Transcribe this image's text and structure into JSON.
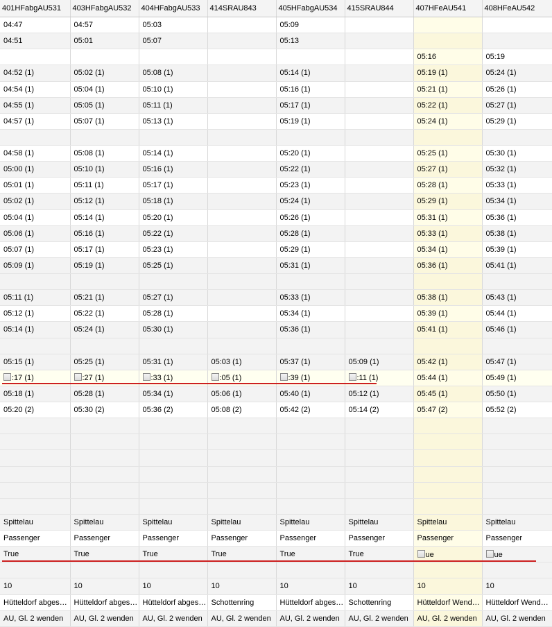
{
  "columns": [
    "401HFabgAU531",
    "403HFabgAU532",
    "404HFabgAU533",
    "414SRAU843",
    "405HFabgAU534",
    "415SRAU844",
    "407HFeAU541",
    "408HFeAU542"
  ],
  "highlight_column": 6,
  "rows": [
    {
      "cells": [
        "04:47",
        "04:57",
        "05:03",
        "",
        "05:09",
        "",
        "",
        ""
      ]
    },
    {
      "cells": [
        "04:51",
        "05:01",
        "05:07",
        "",
        "05:13",
        "",
        "",
        ""
      ]
    },
    {
      "cells": [
        "",
        "",
        "",
        "",
        "",
        "",
        "05:16",
        "05:19"
      ]
    },
    {
      "cells": [
        "04:52 (1)",
        "05:02 (1)",
        "05:08 (1)",
        "",
        "05:14 (1)",
        "",
        "05:19 (1)",
        "05:24 (1)"
      ]
    },
    {
      "cells": [
        "04:54 (1)",
        "05:04 (1)",
        "05:10 (1)",
        "",
        "05:16 (1)",
        "",
        "05:21 (1)",
        "05:26 (1)"
      ]
    },
    {
      "cells": [
        "04:55 (1)",
        "05:05 (1)",
        "05:11 (1)",
        "",
        "05:17 (1)",
        "",
        "05:22 (1)",
        "05:27 (1)"
      ]
    },
    {
      "cells": [
        "04:57 (1)",
        "05:07 (1)",
        "05:13 (1)",
        "",
        "05:19 (1)",
        "",
        "05:24 (1)",
        "05:29 (1)"
      ]
    },
    {
      "cells": [
        "",
        "",
        "",
        "",
        "",
        "",
        "",
        ""
      ]
    },
    {
      "cells": [
        "04:58 (1)",
        "05:08 (1)",
        "05:14 (1)",
        "",
        "05:20 (1)",
        "",
        "05:25 (1)",
        "05:30 (1)"
      ]
    },
    {
      "cells": [
        "05:00 (1)",
        "05:10 (1)",
        "05:16 (1)",
        "",
        "05:22 (1)",
        "",
        "05:27 (1)",
        "05:32 (1)"
      ]
    },
    {
      "cells": [
        "05:01 (1)",
        "05:11 (1)",
        "05:17 (1)",
        "",
        "05:23 (1)",
        "",
        "05:28 (1)",
        "05:33 (1)"
      ]
    },
    {
      "cells": [
        "05:02 (1)",
        "05:12 (1)",
        "05:18 (1)",
        "",
        "05:24 (1)",
        "",
        "05:29 (1)",
        "05:34 (1)"
      ]
    },
    {
      "cells": [
        "05:04 (1)",
        "05:14 (1)",
        "05:20 (1)",
        "",
        "05:26 (1)",
        "",
        "05:31 (1)",
        "05:36 (1)"
      ]
    },
    {
      "cells": [
        "05:06 (1)",
        "05:16 (1)",
        "05:22 (1)",
        "",
        "05:28 (1)",
        "",
        "05:33 (1)",
        "05:38 (1)"
      ]
    },
    {
      "cells": [
        "05:07 (1)",
        "05:17 (1)",
        "05:23 (1)",
        "",
        "05:29 (1)",
        "",
        "05:34 (1)",
        "05:39 (1)"
      ]
    },
    {
      "cells": [
        "05:09 (1)",
        "05:19 (1)",
        "05:25 (1)",
        "",
        "05:31 (1)",
        "",
        "05:36 (1)",
        "05:41 (1)"
      ]
    },
    {
      "cells": [
        "",
        "",
        "",
        "",
        "",
        "",
        "",
        ""
      ]
    },
    {
      "cells": [
        "05:11 (1)",
        "05:21 (1)",
        "05:27 (1)",
        "",
        "05:33 (1)",
        "",
        "05:38 (1)",
        "05:43 (1)"
      ]
    },
    {
      "cells": [
        "05:12 (1)",
        "05:22 (1)",
        "05:28 (1)",
        "",
        "05:34 (1)",
        "",
        "05:39 (1)",
        "05:44 (1)"
      ]
    },
    {
      "cells": [
        "05:14 (1)",
        "05:24 (1)",
        "05:30 (1)",
        "",
        "05:36 (1)",
        "",
        "05:41 (1)",
        "05:46 (1)"
      ]
    },
    {
      "cells": [
        "",
        "",
        "",
        "",
        "",
        "",
        "",
        ""
      ]
    },
    {
      "cells": [
        "05:15 (1)",
        "05:25 (1)",
        "05:31 (1)",
        "05:03 (1)",
        "05:37 (1)",
        "05:09 (1)",
        "05:42 (1)",
        "05:47 (1)"
      ]
    },
    {
      "highlight": true,
      "checkbox_cols": [
        0,
        1,
        2,
        3,
        4,
        5
      ],
      "cells": [
        ":17 (1)",
        ":27 (1)",
        ":33 (1)",
        ":05 (1)",
        ":39 (1)",
        ":11 (1)",
        "05:44 (1)",
        "05:49 (1)"
      ]
    },
    {
      "cells": [
        "05:18 (1)",
        "05:28 (1)",
        "05:34 (1)",
        "05:06 (1)",
        "05:40 (1)",
        "05:12 (1)",
        "05:45 (1)",
        "05:50 (1)"
      ]
    },
    {
      "cells": [
        "05:20 (2)",
        "05:30 (2)",
        "05:36 (2)",
        "05:08 (2)",
        "05:42 (2)",
        "05:14 (2)",
        "05:47 (2)",
        "05:52 (2)"
      ]
    },
    {
      "cells": [
        "",
        "",
        "",
        "",
        "",
        "",
        "",
        ""
      ]
    },
    {
      "cells": [
        "",
        "",
        "",
        "",
        "",
        "",
        "",
        ""
      ]
    },
    {
      "cells": [
        "",
        "",
        "",
        "",
        "",
        "",
        "",
        ""
      ]
    },
    {
      "cells": [
        "",
        "",
        "",
        "",
        "",
        "",
        "",
        ""
      ]
    },
    {
      "cells": [
        "",
        "",
        "",
        "",
        "",
        "",
        "",
        ""
      ]
    },
    {
      "cells": [
        "",
        "",
        "",
        "",
        "",
        "",
        "",
        ""
      ]
    },
    {
      "cells": [
        "Spittelau",
        "Spittelau",
        "Spittelau",
        "Spittelau",
        "Spittelau",
        "Spittelau",
        "Spittelau",
        "Spittelau"
      ]
    },
    {
      "cells": [
        "Passenger",
        "Passenger",
        "Passenger",
        "Passenger",
        "Passenger",
        "Passenger",
        "Passenger",
        "Passenger"
      ]
    },
    {
      "checkbox_cols": [
        6,
        7
      ],
      "cells": [
        "True",
        "True",
        "True",
        "True",
        "True",
        "True",
        "ue",
        "ue"
      ]
    },
    {
      "cells": [
        "",
        "",
        "",
        "",
        "",
        "",
        "",
        ""
      ]
    },
    {
      "cells": [
        "10",
        "10",
        "10",
        "10",
        "10",
        "10",
        "10",
        "10"
      ]
    },
    {
      "cells": [
        "Hütteldorf abges…",
        "Hütteldorf abges…",
        "Hütteldorf abges…",
        "Schottenring",
        "Hütteldorf abges…",
        "Schottenring",
        "Hütteldorf Wend…",
        "Hütteldorf Wend…"
      ]
    },
    {
      "cells": [
        "AU, Gl. 2 wenden",
        "AU, Gl. 2 wenden",
        "AU, Gl. 2 wenden",
        "AU, Gl. 2 wenden",
        "AU, Gl. 2 wenden",
        "AU, Gl. 2 wenden",
        "AU, Gl. 2 wenden",
        "AU, Gl. 2 wenden"
      ]
    }
  ]
}
